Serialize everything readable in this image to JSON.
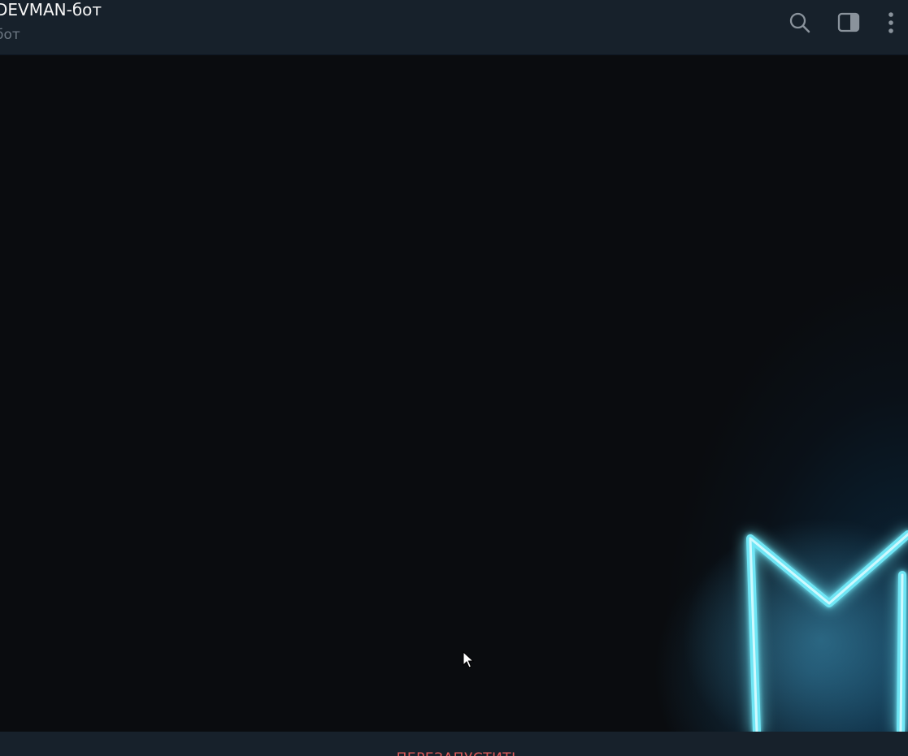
{
  "header": {
    "title": "DEVMAN-бот",
    "subtitle": "бот",
    "icons": {
      "search": "search-icon",
      "sidebar": "sidebar-toggle-icon",
      "more": "more-vertical-icon"
    }
  },
  "chat": {
    "background_logo": "neon-m-logo"
  },
  "bottom_bar": {
    "action_label": "ПЕРЕЗАПУСТИТЬ"
  },
  "colors": {
    "header_bg": "#17212b",
    "title": "#f5f5f5",
    "subtitle": "#6d7883",
    "icon": "#8a939c",
    "neon": "#6fe6f5",
    "action": "#e05a5a"
  }
}
